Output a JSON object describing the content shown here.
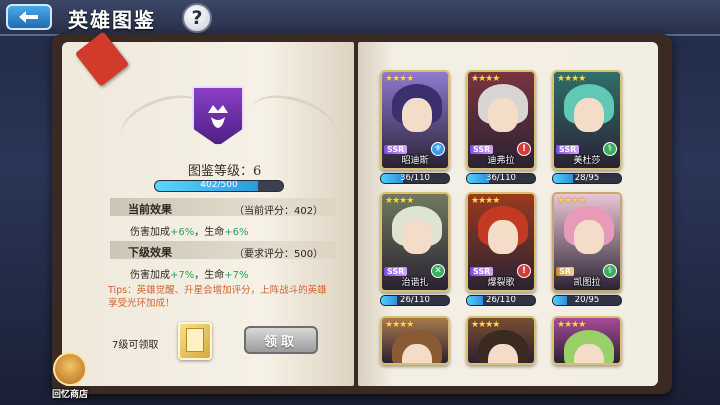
{
  "header": {
    "title": "英雄图鉴",
    "help_label": "?"
  },
  "codex": {
    "level_label": "图鉴等级：6",
    "progress": {
      "current": 402,
      "max": 500,
      "text": "402/500"
    },
    "current_effect": {
      "heading": "当前效果",
      "score": "（当前评分：402）",
      "line_prefix": "伤害加成",
      "line_value1": "+6%",
      "line_mid": "，生命",
      "line_value2": "+6%"
    },
    "next_effect": {
      "heading": "下级效果",
      "score": "（要求评分：500）",
      "line_prefix": "伤害加成",
      "line_value1": "+7%",
      "line_mid": "，生命",
      "line_value2": "+7%"
    },
    "tips": "Tips：英雄觉醒、升星会增加评分，上阵战斗的英雄享受光环加成！",
    "unlock_label": "7级可领取",
    "claim_label": "领取"
  },
  "shop": {
    "label": "回忆商店"
  },
  "heroes": [
    {
      "name": "昭迪斯",
      "stars": "★★★★",
      "rarity": "SSR",
      "count": "36/110",
      "current": 36,
      "max": 110,
      "hair": "#3b2f6e",
      "bg": "#8e7ad1",
      "role_color": "#3a9be8",
      "role": "⚜"
    },
    {
      "name": "迪弗拉",
      "stars": "★★★★",
      "rarity": "SSR",
      "count": "36/110",
      "current": 36,
      "max": 110,
      "hair": "#d8d6d2",
      "bg": "#7a3440",
      "role_color": "#d83a3a",
      "role": "!"
    },
    {
      "name": "美杜莎",
      "stars": "★★★★",
      "rarity": "SSR",
      "count": "28/95",
      "current": 28,
      "max": 95,
      "hair": "#5fc9b4",
      "bg": "#2f6f6a",
      "role_color": "#3cae62",
      "role": "⚕"
    },
    {
      "name": "治谐扎",
      "stars": "★★★★",
      "rarity": "SSR",
      "count": "26/110",
      "current": 26,
      "max": 110,
      "hair": "#dfe4d2",
      "bg": "#6f7a5e",
      "role_color": "#3cae62",
      "role": "✕"
    },
    {
      "name": "爆裂歌",
      "stars": "★★★★",
      "rarity": "SSR",
      "count": "26/110",
      "current": 26,
      "max": 110,
      "hair": "#c23a22",
      "bg": "#9a3a1e",
      "role_color": "#d83a3a",
      "role": "!"
    },
    {
      "name": "凯图拉",
      "stars": "★★★★",
      "rarity": "SR",
      "count": "20/95",
      "current": 20,
      "max": 95,
      "hair": "#e79bb8",
      "bg": "#e9c7d4",
      "role_color": "#3cae62",
      "role": "⚕"
    },
    {
      "name": "",
      "stars": "★★★★",
      "rarity": "",
      "count": "",
      "current": 0,
      "max": 0,
      "hair": "#8a5a34",
      "bg": "#a87a4e",
      "role_color": "",
      "role": ""
    },
    {
      "name": "",
      "stars": "★★★★",
      "rarity": "",
      "count": "",
      "current": 0,
      "max": 0,
      "hair": "#3b2a22",
      "bg": "#7a4e30",
      "role_color": "",
      "role": ""
    },
    {
      "name": "",
      "stars": "★★★★",
      "rarity": "",
      "count": "",
      "current": 0,
      "max": 0,
      "hair": "#9ad06a",
      "bg": "#a84a9a",
      "role_color": "",
      "role": ""
    }
  ]
}
